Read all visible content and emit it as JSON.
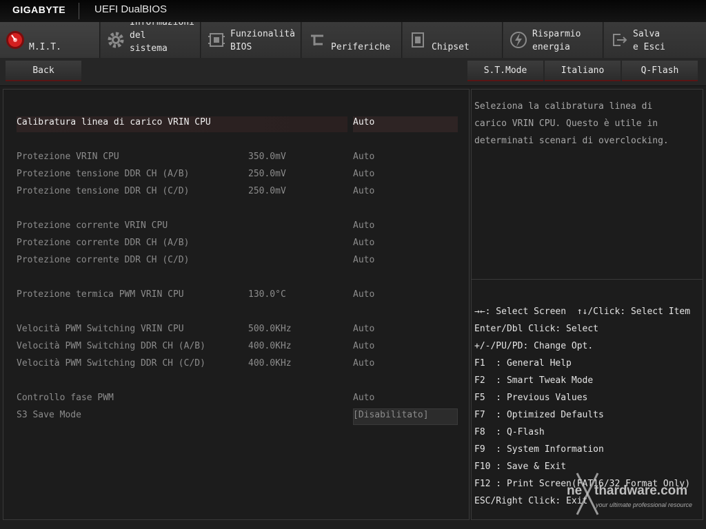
{
  "header": {
    "brand": "GIGABYTE",
    "product": "UEFI DualBIOS"
  },
  "tabs": [
    {
      "label": "M.I.T.",
      "icon": "mit-icon"
    },
    {
      "label": "Informazioni\ndel\nsistema",
      "icon": "gear-icon"
    },
    {
      "label": "Funzionalità\nBIOS",
      "icon": "chip-icon"
    },
    {
      "label": "Periferiche",
      "icon": "plug-icon"
    },
    {
      "label": "Chipset",
      "icon": "chipset-icon"
    },
    {
      "label": "Risparmio\nenergia",
      "icon": "lightning-icon"
    },
    {
      "label": "Salva\ne Esci",
      "icon": "exit-icon"
    }
  ],
  "toolbar": {
    "back": "Back",
    "stmode": "S.T.Mode",
    "language": "Italiano",
    "qflash": "Q-Flash"
  },
  "settings": [
    {
      "label": "Calibratura linea di carico VRIN CPU",
      "value": "",
      "option": "Auto"
    },
    {
      "label": "Protezione VRIN CPU",
      "value": "350.0mV",
      "option": "Auto"
    },
    {
      "label": "Protezione tensione DDR CH (A/B)",
      "value": "250.0mV",
      "option": "Auto"
    },
    {
      "label": "Protezione tensione DDR CH (C/D)",
      "value": "250.0mV",
      "option": "Auto"
    },
    {
      "label": "Protezione corrente VRIN CPU",
      "value": "",
      "option": "Auto"
    },
    {
      "label": "Protezione corrente DDR CH (A/B)",
      "value": "",
      "option": "Auto"
    },
    {
      "label": "Protezione corrente DDR CH (C/D)",
      "value": "",
      "option": "Auto"
    },
    {
      "label": "Protezione termica PWM VRIN CPU",
      "value": "130.0°C",
      "option": "Auto"
    },
    {
      "label": "Velocità PWM Switching VRIN CPU",
      "value": "500.0KHz",
      "option": "Auto"
    },
    {
      "label": "Velocità PWM Switching DDR CH (A/B)",
      "value": "400.0KHz",
      "option": "Auto"
    },
    {
      "label": "Velocità PWM Switching DDR CH (C/D)",
      "value": "400.0KHz",
      "option": "Auto"
    },
    {
      "label": "Controllo fase PWM",
      "value": "",
      "option": "Auto"
    },
    {
      "label": "S3 Save Mode",
      "value": "",
      "option": "[Disabilitato]"
    }
  ],
  "help_text": "Seleziona la calibratura linea di\ncarico VRIN CPU. Questo è utile in\ndeterminati scenari di overclocking.",
  "key_help": [
    "→←: Select Screen  ↑↓/Click: Select Item",
    "Enter/Dbl Click: Select",
    "+/-/PU/PD: Change Opt.",
    "F1  : General Help",
    "F2  : Smart Tweak Mode",
    "F5  : Previous Values",
    "F7  : Optimized Defaults",
    "F8  : Q-Flash",
    "F9  : System Information",
    "F10 : Save & Exit",
    "F12 : Print Screen(FAT16/32 Format Only)",
    "ESC/Right Click: Exit"
  ],
  "watermark": {
    "prefix": "ne",
    "name": "thardware.com",
    "tagline": "your ultimate professional resource"
  },
  "colors": {
    "accent": "#cc1a1a",
    "background": "#1e1e1e"
  }
}
